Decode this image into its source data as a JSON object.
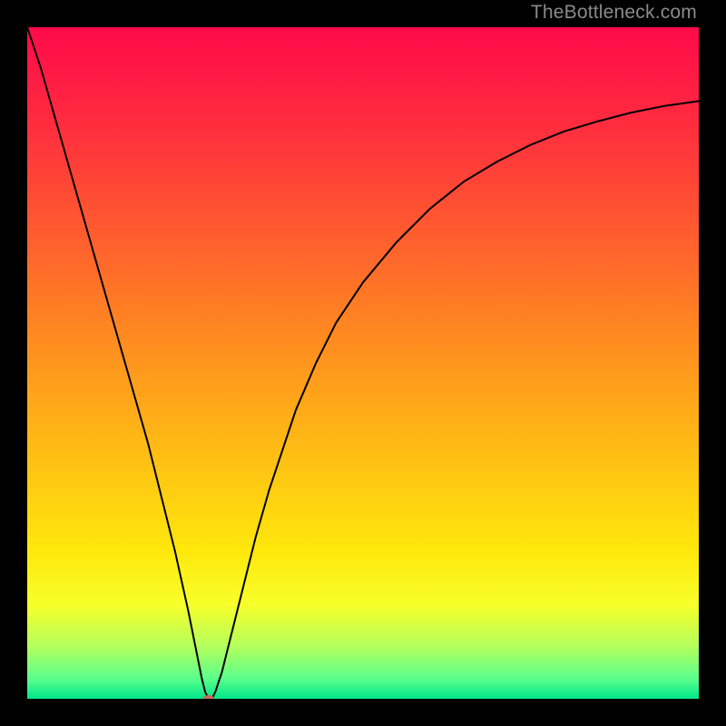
{
  "watermark": "TheBottleneck.com",
  "chart_data": {
    "type": "line",
    "title": "",
    "xlabel": "",
    "ylabel": "",
    "xlim": [
      0,
      100
    ],
    "ylim": [
      0,
      100
    ],
    "background_gradient": {
      "stops": [
        {
          "offset": 0.0,
          "color": "#ff0a4a"
        },
        {
          "offset": 0.14,
          "color": "#ff2b3f"
        },
        {
          "offset": 0.3,
          "color": "#ff5a2f"
        },
        {
          "offset": 0.46,
          "color": "#ff8a20"
        },
        {
          "offset": 0.62,
          "color": "#ffb915"
        },
        {
          "offset": 0.78,
          "color": "#ffe80c"
        },
        {
          "offset": 0.86,
          "color": "#f8ff2a"
        },
        {
          "offset": 0.92,
          "color": "#b6ff5a"
        },
        {
          "offset": 0.97,
          "color": "#5cff8c"
        },
        {
          "offset": 1.0,
          "color": "#00e58a"
        }
      ]
    },
    "minimum_marker": {
      "x": 27,
      "y": 0,
      "color": "#c96a57",
      "rx": 6,
      "ry": 4
    },
    "series": [
      {
        "name": "bottleneck-curve",
        "color": "#000000",
        "width": 2,
        "points": [
          {
            "x": 0,
            "y": 100
          },
          {
            "x": 2,
            "y": 94
          },
          {
            "x": 4,
            "y": 87
          },
          {
            "x": 6,
            "y": 80
          },
          {
            "x": 8,
            "y": 73
          },
          {
            "x": 10,
            "y": 66
          },
          {
            "x": 12,
            "y": 59
          },
          {
            "x": 14,
            "y": 52
          },
          {
            "x": 16,
            "y": 45
          },
          {
            "x": 18,
            "y": 38
          },
          {
            "x": 20,
            "y": 30
          },
          {
            "x": 22,
            "y": 22
          },
          {
            "x": 24,
            "y": 13
          },
          {
            "x": 25,
            "y": 8
          },
          {
            "x": 26,
            "y": 3
          },
          {
            "x": 26.5,
            "y": 1
          },
          {
            "x": 27,
            "y": 0
          },
          {
            "x": 27.5,
            "y": 0
          },
          {
            "x": 28,
            "y": 1
          },
          {
            "x": 29,
            "y": 4
          },
          {
            "x": 30,
            "y": 8
          },
          {
            "x": 32,
            "y": 16
          },
          {
            "x": 34,
            "y": 24
          },
          {
            "x": 36,
            "y": 31
          },
          {
            "x": 38,
            "y": 37
          },
          {
            "x": 40,
            "y": 43
          },
          {
            "x": 43,
            "y": 50
          },
          {
            "x": 46,
            "y": 56
          },
          {
            "x": 50,
            "y": 62
          },
          {
            "x": 55,
            "y": 68
          },
          {
            "x": 60,
            "y": 73
          },
          {
            "x": 65,
            "y": 77
          },
          {
            "x": 70,
            "y": 80
          },
          {
            "x": 75,
            "y": 82.5
          },
          {
            "x": 80,
            "y": 84.5
          },
          {
            "x": 85,
            "y": 86
          },
          {
            "x": 90,
            "y": 87.3
          },
          {
            "x": 95,
            "y": 88.3
          },
          {
            "x": 100,
            "y": 89
          }
        ]
      }
    ]
  }
}
